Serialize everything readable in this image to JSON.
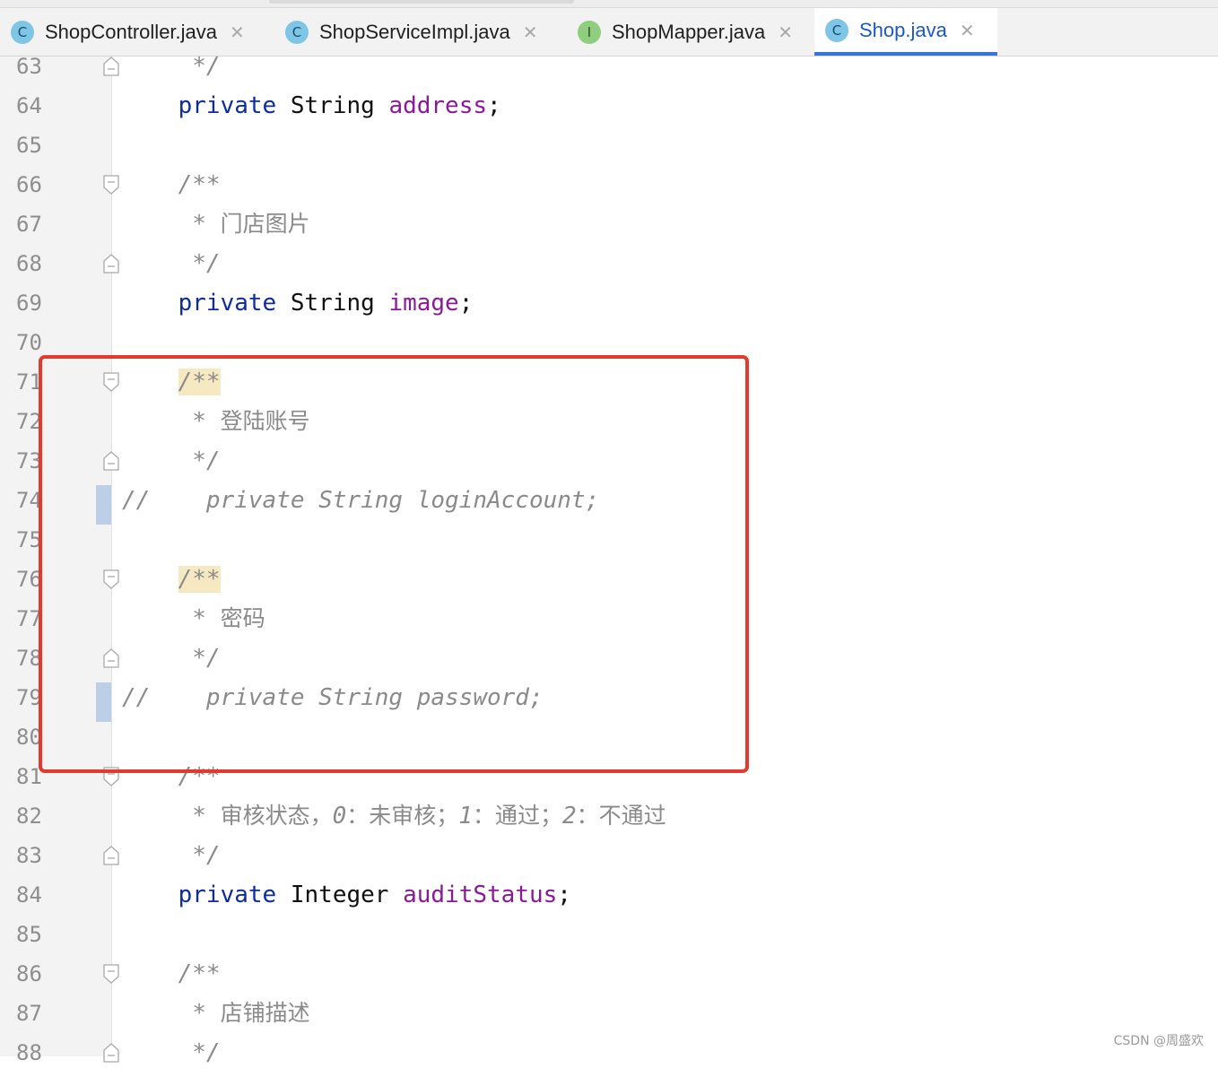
{
  "tabs": [
    {
      "label": "ShopController.java",
      "icon": "C",
      "kind": "class",
      "active": false
    },
    {
      "label": "ShopServiceImpl.java",
      "icon": "C",
      "kind": "class",
      "active": false
    },
    {
      "label": "ShopMapper.java",
      "icon": "I",
      "kind": "interface",
      "active": false
    },
    {
      "label": "Shop.java",
      "icon": "C",
      "kind": "class",
      "active": true
    }
  ],
  "close_glyph": "✕",
  "lines": [
    {
      "n": "63",
      "html": "     <span class='doc'>*/</span>"
    },
    {
      "n": "64",
      "html": "    <span class='kw'>private</span> String <span class='fld'>address</span>;"
    },
    {
      "n": "65",
      "html": ""
    },
    {
      "n": "66",
      "html": "    <span class='doc'>/**</span>"
    },
    {
      "n": "67",
      "html": "     <span class='doc'>* </span><span class='zh'>门店图片</span>"
    },
    {
      "n": "68",
      "html": "     <span class='doc'>*/</span>"
    },
    {
      "n": "69",
      "html": "    <span class='kw'>private</span> String <span class='fld'>image</span>;"
    },
    {
      "n": "70",
      "html": ""
    },
    {
      "n": "71",
      "html": "    <span class='doc hl'>/**</span>"
    },
    {
      "n": "72",
      "html": "     <span class='doc'>* </span><span class='zh'>登陆账号</span>"
    },
    {
      "n": "73",
      "html": "     <span class='doc'>*/</span>"
    },
    {
      "n": "74",
      "html": "<span class='cm'>//    private String loginAccount;</span>"
    },
    {
      "n": "75",
      "html": ""
    },
    {
      "n": "76",
      "html": "    <span class='doc hl'>/**</span>"
    },
    {
      "n": "77",
      "html": "     <span class='doc'>* </span><span class='zh'>密码</span>"
    },
    {
      "n": "78",
      "html": "     <span class='doc'>*/</span>"
    },
    {
      "n": "79",
      "html": "<span class='cm'>//    private String password;</span>"
    },
    {
      "n": "80",
      "html": ""
    },
    {
      "n": "81",
      "html": "    <span class='doc'>/**</span>"
    },
    {
      "n": "82",
      "html": "     <span class='doc'>* </span><span class='zh'>审核状态，</span><span class='doc'>0</span><span class='zh'>：未审核；</span><span class='doc'>1</span><span class='zh'>：通过；</span><span class='doc'>2</span><span class='zh'>：不通过</span>"
    },
    {
      "n": "83",
      "html": "     <span class='doc'>*/</span>"
    },
    {
      "n": "84",
      "html": "    <span class='kw'>private</span> Integer <span class='fld'>auditStatus</span>;"
    },
    {
      "n": "85",
      "html": ""
    },
    {
      "n": "86",
      "html": "    <span class='doc'>/**</span>"
    },
    {
      "n": "87",
      "html": "     <span class='doc'>* </span><span class='zh'>店铺描述</span>"
    },
    {
      "n": "88",
      "html": "     <span class='doc'>*/</span>"
    }
  ],
  "fold_open_lines": [
    "66",
    "71",
    "76",
    "81",
    "86"
  ],
  "fold_close_lines": [
    "63",
    "68",
    "73",
    "78",
    "83",
    "88"
  ],
  "changed_lines": [
    "74",
    "79"
  ],
  "highlight_color": "#e23a2c",
  "watermark": "CSDN @周盛欢"
}
